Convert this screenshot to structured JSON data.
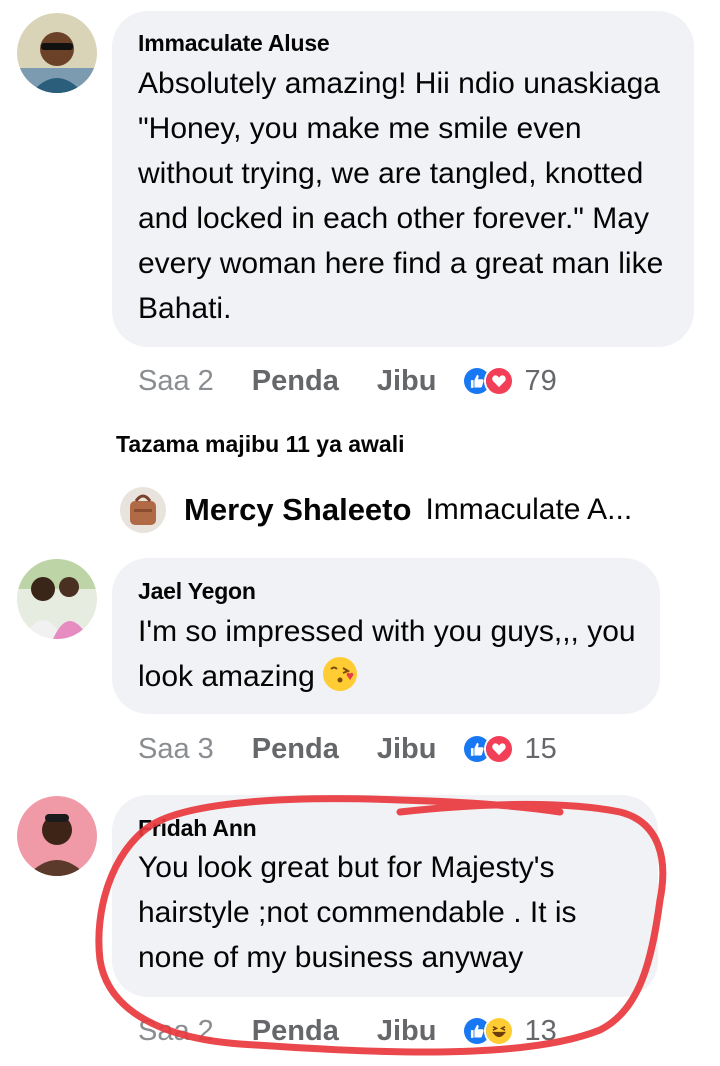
{
  "comments": [
    {
      "author": "Immaculate Aluse",
      "text": "Absolutely amazing! Hii ndio unaskiaga \"Honey, you make me smile even without trying, we are tangled, knotted and locked in each other forever.\" May every woman here find a great man like Bahati.",
      "time": "Saa 2",
      "like_label": "Penda",
      "reply_label": "Jibu",
      "reactions": [
        "like",
        "love"
      ],
      "reaction_count": "79"
    },
    {
      "author": "Jael Yegon",
      "text": "I'm so impressed with you guys,,, you look amazing",
      "emoji": "face-blowing-kiss",
      "time": "Saa 3",
      "like_label": "Penda",
      "reply_label": "Jibu",
      "reactions": [
        "like",
        "love"
      ],
      "reaction_count": "15"
    },
    {
      "author": "Fridah Ann",
      "text": "You look great but for Majesty's hairstyle ;not commendable . It is none of my business anyway",
      "time": "Saa 2",
      "like_label": "Penda",
      "reply_label": "Jibu",
      "reactions": [
        "like",
        "haha"
      ],
      "reaction_count": "13"
    }
  ],
  "view_previous_replies": "Tazama majibu 11 ya awali",
  "reply_preview": {
    "author": "Mercy Shaleeto",
    "text": "Immaculate A..."
  },
  "colors": {
    "bubble": "#f0f2f5",
    "meta_text": "#65676b",
    "like_blue": "#1877f2",
    "love_red": "#f33e58",
    "annotation_red": "#e8383d"
  },
  "icons": [
    "like-reaction-icon",
    "love-reaction-icon",
    "haha-reaction-icon",
    "kiss-emoji-icon"
  ]
}
